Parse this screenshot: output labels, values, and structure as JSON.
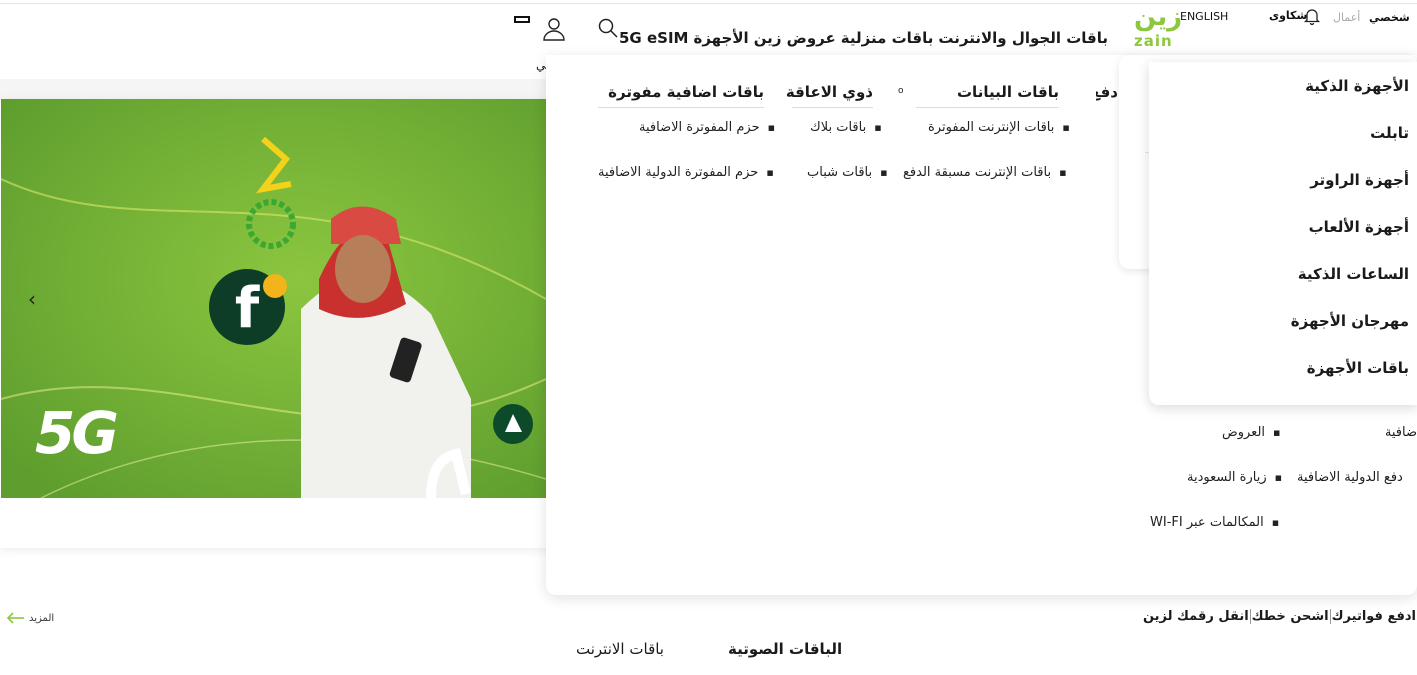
{
  "header": {
    "personal": "شخصي",
    "business": "أعمال",
    "complaints": "شكاوى",
    "language": "ENGLISH",
    "logo_ar": "زين",
    "logo_en": "zain",
    "account_label": "حسابي"
  },
  "main_nav": {
    "items": [
      "باقات الجوال والانترنت",
      "باقات منزلية",
      "عروض زين",
      "الأجهزة",
      "5G eSIM"
    ]
  },
  "mega_menu": {
    "columns": [
      {
        "title": "دفع",
        "items": []
      },
      {
        "title": "باقات البيانات",
        "items": [
          "باقات الإنترنت المفوترة",
          "باقات الإنترنت مسبقة الدفع"
        ]
      },
      {
        "title": "ذوي الاعاقة",
        "items": [
          "باقات بلاك",
          "باقات شباب"
        ]
      },
      {
        "title": "باقات اضافية مفوترة",
        "items": [
          "حزم المفوترة الاضافية",
          "حزم المفوترة الدولية الاضافية"
        ]
      }
    ],
    "lower_items": [
      "العروض",
      "زيارة السعودية",
      "المكالمات عبر WI-FI"
    ],
    "lower_partial": [
      "ضافية",
      "دفع الدولية الاضافية"
    ]
  },
  "devices_menu": {
    "items": [
      "الأجهزة الذكية",
      "تابلت",
      "أجهزة الراوتر",
      "أجهزة الألعاب",
      "الساعات الذكية",
      "مهرجان الأجهزة",
      "باقات الأجهزة"
    ]
  },
  "hero": {
    "badge": "5G"
  },
  "quick_links": [
    "ادفع فواتيرك",
    "اشحن خطك",
    "انقل رقمك لزين"
  ],
  "more_label": "المزيد",
  "tabs": [
    "الباقات الصوتية",
    "باقات الانترنت"
  ],
  "colors": {
    "brand_green": "#8dc63f",
    "hero_green": "#6aa832",
    "dark_green": "#0c4a2a"
  }
}
